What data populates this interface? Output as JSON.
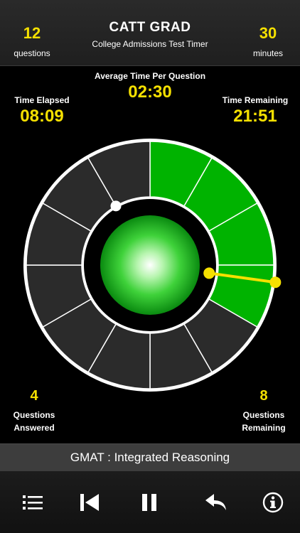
{
  "header": {
    "title": "CATT GRAD",
    "subtitle": "College Admissions Test Timer",
    "questions_count": "12",
    "questions_label": "questions",
    "minutes_count": "30",
    "minutes_label": "minutes"
  },
  "timer": {
    "avg_label": "Average Time Per Question",
    "avg_value": "02:30",
    "elapsed_label": "Time Elapsed",
    "elapsed_value": "08:09",
    "remaining_label": "Time Remaining",
    "remaining_value": "21:51"
  },
  "progress": {
    "answered_count": "4",
    "answered_label_1": "Questions",
    "answered_label_2": "Answered",
    "remaining_count": "8",
    "remaining_label_1": "Questions",
    "remaining_label_2": "Remaining"
  },
  "dial": {
    "total_segments": 12,
    "completed_segments": 4,
    "elapsed_fraction": 0.2717,
    "segment_color": "#00b300",
    "empty_color": "#2b2b2b",
    "hand_color": "#f5e000"
  },
  "subject": "GMAT : Integrated Reasoning",
  "toolbar": {
    "icons": [
      "list-icon",
      "skip-back-icon",
      "pause-icon",
      "undo-icon",
      "info-icon"
    ]
  },
  "colors": {
    "accent": "#f5e000",
    "progress": "#00b300",
    "background": "#000000"
  }
}
